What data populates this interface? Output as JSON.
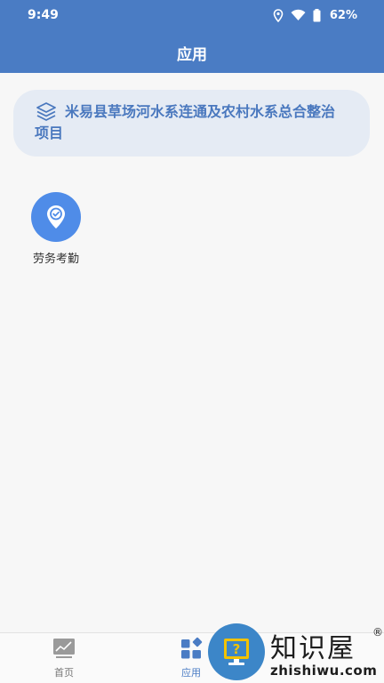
{
  "status_bar": {
    "time": "9:49",
    "battery": "62%"
  },
  "header": {
    "title": "应用"
  },
  "project": {
    "name": "米易县草场河水系连通及农村水系总合整治项目"
  },
  "apps": [
    {
      "label": "劳务考勤",
      "icon": "location-check-icon"
    }
  ],
  "bottom_nav": [
    {
      "label": "首页",
      "icon": "chart-icon",
      "active": false
    },
    {
      "label": "应用",
      "icon": "apps-icon",
      "active": true
    }
  ],
  "watermark": {
    "title": "知识屋",
    "registered": "®",
    "url": "zhishiwu.com"
  },
  "colors": {
    "header": "#4a7cc4",
    "accent": "#4f8ce8",
    "card": "#e5ebf4"
  }
}
